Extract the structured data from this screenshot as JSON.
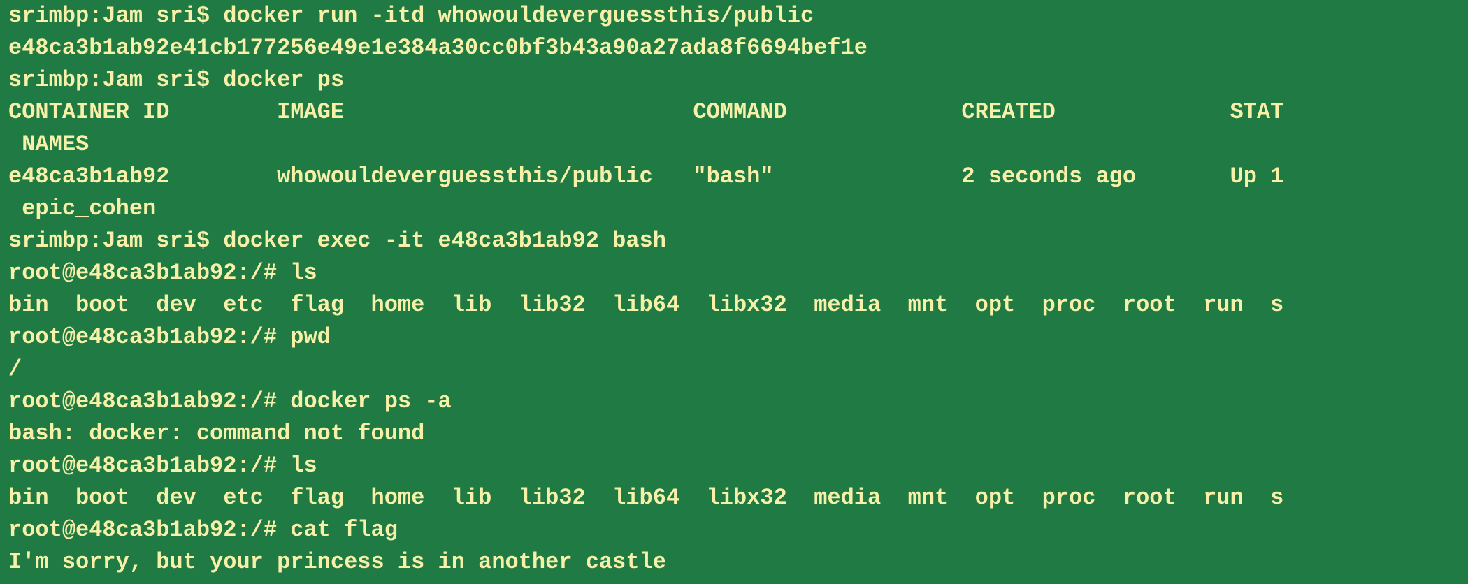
{
  "terminal": {
    "background": "#1f7a44",
    "text_color": "#f7f0a8",
    "lines": [
      {
        "text": "srimbp:Jam sri$ docker run -itd whowouldeverguessthis/public",
        "prompt": true
      },
      {
        "text": "e48ca3b1ab92e41cb177256e49e1e384a30cc0bf3b43a90a27ada8f6694bef1e",
        "prompt": false
      },
      {
        "text": "srimbp:Jam sri$ docker ps",
        "prompt": true
      },
      {
        "text": "CONTAINER ID        IMAGE                          COMMAND             CREATED             STAT",
        "prompt": false
      },
      {
        "text": " NAMES",
        "prompt": false
      },
      {
        "text": "e48ca3b1ab92        whowouldeverguessthis/public   \"bash\"              2 seconds ago       Up 1",
        "prompt": false
      },
      {
        "text": " epic_cohen",
        "prompt": false
      },
      {
        "text": "srimbp:Jam sri$ docker exec -it e48ca3b1ab92 bash",
        "prompt": true
      },
      {
        "text": "root@e48ca3b1ab92:/# ls",
        "prompt": true
      },
      {
        "text": "bin  boot  dev  etc  flag  home  lib  lib32  lib64  libx32  media  mnt  opt  proc  root  run  s",
        "prompt": false
      },
      {
        "text": "root@e48ca3b1ab92:/# pwd",
        "prompt": true
      },
      {
        "text": "/",
        "prompt": false
      },
      {
        "text": "root@e48ca3b1ab92:/# docker ps -a",
        "prompt": true
      },
      {
        "text": "bash: docker: command not found",
        "prompt": false
      },
      {
        "text": "root@e48ca3b1ab92:/# ls",
        "prompt": true
      },
      {
        "text": "bin  boot  dev  etc  flag  home  lib  lib32  lib64  libx32  media  mnt  opt  proc  root  run  s",
        "prompt": false
      },
      {
        "text": "root@e48ca3b1ab92:/# cat flag",
        "prompt": true
      },
      {
        "text": "I'm sorry, but your princess is in another castle",
        "prompt": false
      }
    ]
  }
}
